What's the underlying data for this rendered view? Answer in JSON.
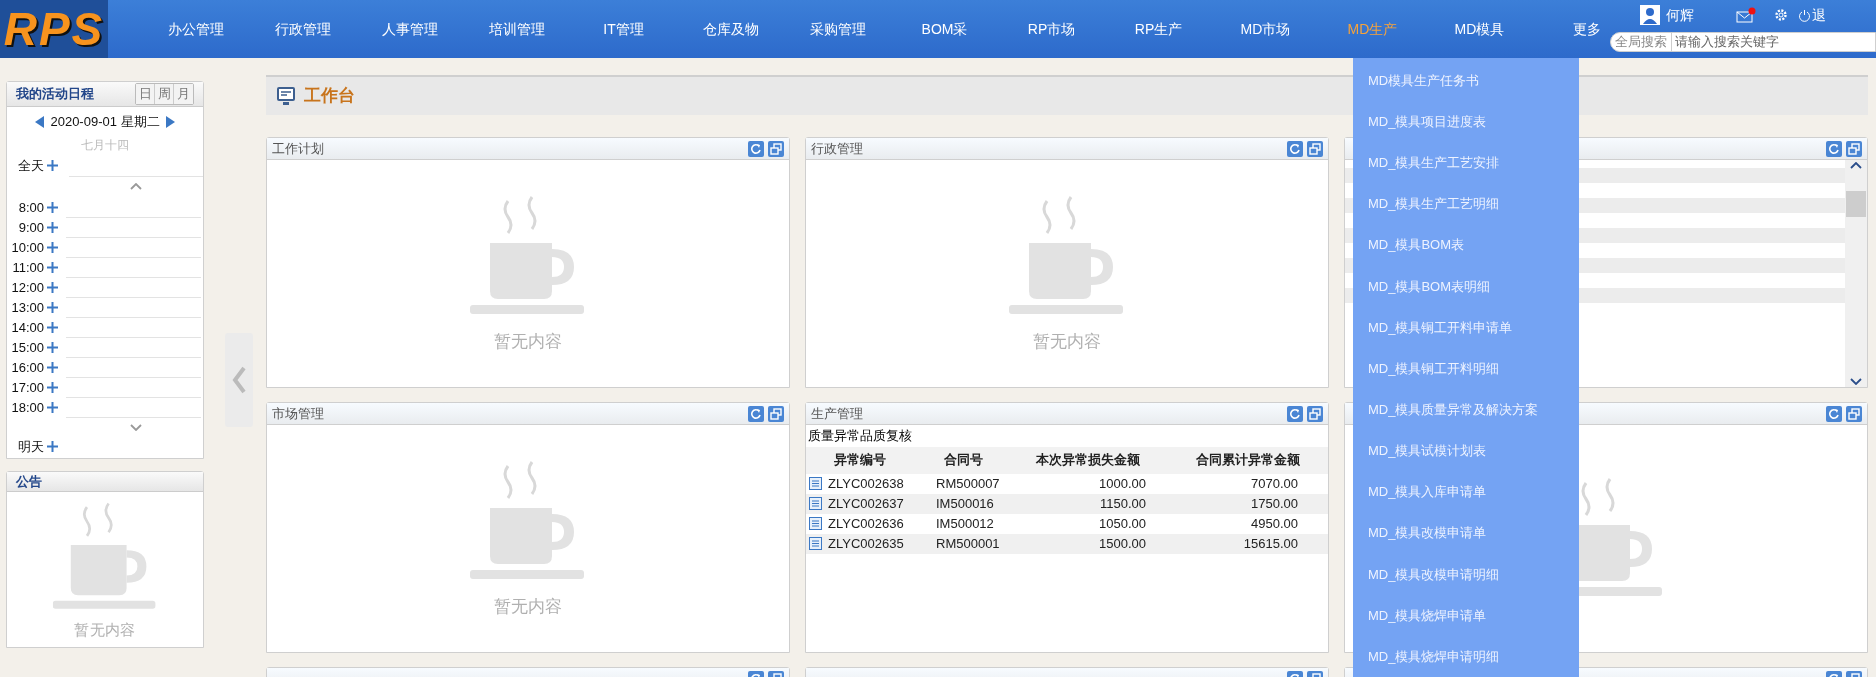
{
  "header": {
    "logo": "RPS",
    "nav": [
      {
        "label": "办公管理",
        "selected": false
      },
      {
        "label": "行政管理",
        "selected": false
      },
      {
        "label": "人事管理",
        "selected": false
      },
      {
        "label": "培训管理",
        "selected": false
      },
      {
        "label": "IT管理",
        "selected": false
      },
      {
        "label": "仓库及物",
        "selected": false
      },
      {
        "label": "采购管理",
        "selected": false
      },
      {
        "label": "BOM采",
        "selected": false
      },
      {
        "label": "RP市场",
        "selected": false
      },
      {
        "label": "RP生产",
        "selected": false
      },
      {
        "label": "MD市场",
        "selected": false
      },
      {
        "label": "MD生产",
        "selected": true
      },
      {
        "label": "MD模具",
        "selected": false
      },
      {
        "label": "更多",
        "selected": false
      }
    ],
    "user": "何辉",
    "logout": "退",
    "search": {
      "label": "全局搜索",
      "placeholder": "请输入搜索关键字"
    }
  },
  "dropdown": [
    "MD模具生产任务书",
    "MD_模具项目进度表",
    "MD_模具生产工艺安排",
    "MD_模具生产工艺明细",
    "MD_模具BOM表",
    "MD_模具BOM表明细",
    "MD_模具铜工开料申请单",
    "MD_模具铜工开料明细",
    "MD_模具质量异常及解决方案",
    "MD_模具试模计划表",
    "MD_模具入库申请单",
    "MD_模具改模申请单",
    "MD_模具改模申请明细",
    "MD_模具烧焊申请单",
    "MD_模具烧焊申请明细"
  ],
  "calendar": {
    "title": "我的活动日程",
    "views": [
      "日",
      "周",
      "月"
    ],
    "date": "2020-09-01 星期二",
    "lunar": "七月十四",
    "all_day": "全天",
    "hours": [
      "8:00",
      "9:00",
      "10:00",
      "11:00",
      "12:00",
      "13:00",
      "14:00",
      "15:00",
      "16:00",
      "17:00",
      "18:00"
    ],
    "tomorrow": "明天"
  },
  "notice": {
    "title": "公告",
    "empty_text": "暂无内容"
  },
  "workbench": {
    "title": "工作台"
  },
  "panels": [
    {
      "kind": "empty",
      "title": "工作计划",
      "empty_text": "暂无内容"
    },
    {
      "kind": "empty",
      "title": "行政管理",
      "empty_text": "暂无内容"
    },
    {
      "kind": "list"
    },
    {
      "kind": "empty",
      "title": "市场管理",
      "empty_text": "暂无内容"
    },
    {
      "kind": "table",
      "title": "生产管理",
      "table": {
        "caption": "质量异常品质复核",
        "columns": [
          "异常编号",
          "合同号",
          "本次异常损失金额",
          "合同累计异常金额"
        ],
        "rows": [
          [
            "ZLYC002638",
            "RM500007",
            "1000.00",
            "7070.00"
          ],
          [
            "ZLYC002637",
            "IM500016",
            "1150.00",
            "1750.00"
          ],
          [
            "ZLYC002636",
            "IM500012",
            "1050.00",
            "4950.00"
          ],
          [
            "ZLYC002635",
            "RM500001",
            "1500.00",
            "15615.00"
          ]
        ]
      }
    },
    {
      "kind": "empty"
    },
    {
      "kind": "stub"
    },
    {
      "kind": "stub"
    },
    {
      "kind": "stub"
    }
  ]
}
